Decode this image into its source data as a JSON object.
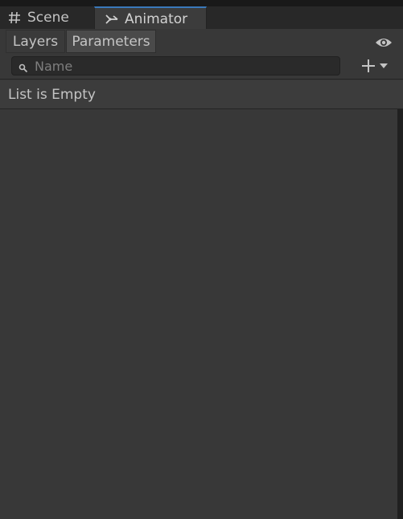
{
  "tabs": [
    {
      "label": "Scene",
      "icon": "grid-icon",
      "active": false
    },
    {
      "label": "Animator",
      "icon": "animator-icon",
      "active": true
    }
  ],
  "sub_toolbar": {
    "layers_label": "Layers",
    "parameters_label": "Parameters",
    "active": "Parameters"
  },
  "search": {
    "placeholder": "Name",
    "value": ""
  },
  "list": {
    "empty_text": "List is Empty"
  },
  "colors": {
    "accent": "#3a79bb",
    "panel": "#383838",
    "text": "#c4c4c4"
  }
}
